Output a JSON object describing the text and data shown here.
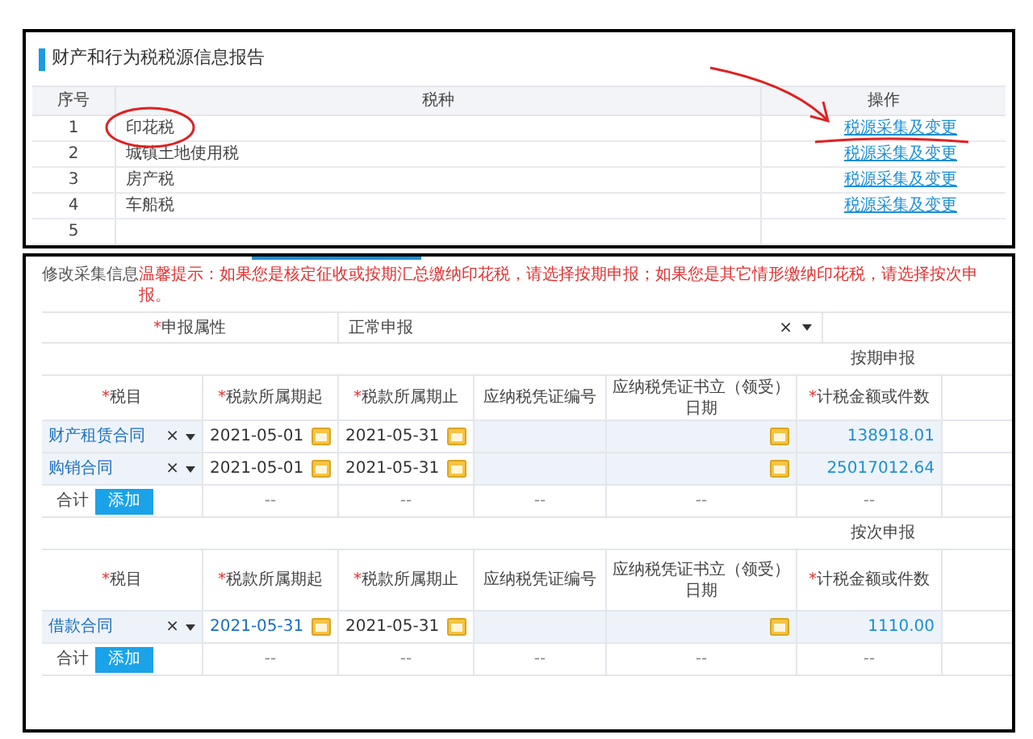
{
  "report": {
    "title": "财产和行为税税源信息报告",
    "columns": [
      "序号",
      "税种",
      "操作"
    ],
    "rows": [
      {
        "no": "1",
        "tax": "印花税",
        "action": "税源采集及变更"
      },
      {
        "no": "2",
        "tax": "城镇土地使用税",
        "action": "税源采集及变更"
      },
      {
        "no": "3",
        "tax": "房产税",
        "action": "税源采集及变更"
      },
      {
        "no": "4",
        "tax": "车船税",
        "action": "税源采集及变更"
      },
      {
        "no": "5"
      }
    ]
  },
  "form": {
    "required_mark": "*",
    "heading": "修改采集信息",
    "notice": "温馨提示：如果您是核定征收或按期汇总缴纳印花税，请选择按期申报；如果您是其它情形缴纳印花税，请选择按次申报。",
    "attribute": {
      "label": "申报属性",
      "required": true,
      "value": "正常申报",
      "clear": "×"
    },
    "sections": [
      {
        "title": "按期申报",
        "columns": [
          {
            "label": "税目",
            "required": true
          },
          {
            "label": "税款所属期起",
            "required": true
          },
          {
            "label": "税款所属期止",
            "required": true
          },
          {
            "label": "应纳税凭证编号",
            "required": false
          },
          {
            "label": "应纳税凭证书立（领受）日期",
            "required": false
          },
          {
            "label": "计税金额或件数",
            "required": true
          }
        ],
        "rows": [
          {
            "item": "财产租赁合同",
            "clear": "×",
            "start": "2021-05-01",
            "start_focused": false,
            "end": "2021-05-31",
            "amount": "138918.01"
          },
          {
            "item": "购销合同",
            "clear": "×",
            "start": "2021-05-01",
            "start_focused": false,
            "end": "2021-05-31",
            "amount": "25017012.64"
          }
        ],
        "total_label": "合计",
        "add_button": "添加",
        "totals": [
          "--",
          "--",
          "--",
          "--",
          "--"
        ]
      },
      {
        "title": "按次申报",
        "columns": [
          {
            "label": "税目",
            "required": true
          },
          {
            "label": "税款所属期起",
            "required": true
          },
          {
            "label": "税款所属期止",
            "required": true
          },
          {
            "label": "应纳税凭证编号",
            "required": false
          },
          {
            "label": "应纳税凭证书立（领受）日期",
            "required": false
          },
          {
            "label": "计税金额或件数",
            "required": true
          }
        ],
        "rows": [
          {
            "item": "借款合同",
            "clear": "×",
            "start": "2021-05-31",
            "start_focused": true,
            "end": "2021-05-31",
            "amount": "1110.00"
          }
        ],
        "total_label": "合计",
        "add_button": "添加",
        "totals": [
          "--",
          "--",
          "--",
          "--",
          "--"
        ]
      }
    ]
  }
}
